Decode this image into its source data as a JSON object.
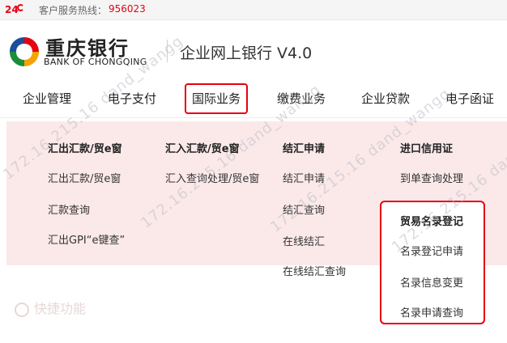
{
  "topbar": {
    "hotline_label": "客户服务热线：",
    "hotline_number": "956023",
    "badge_text": "24"
  },
  "brand": {
    "name_cn": "重庆银行",
    "name_en": "BANK OF CHONGQING",
    "portal_title": "企业网上银行 V4.0"
  },
  "nav": {
    "items": [
      {
        "label": "企业管理"
      },
      {
        "label": "电子支付"
      },
      {
        "label": "国际业务"
      },
      {
        "label": "缴费业务"
      },
      {
        "label": "企业贷款"
      },
      {
        "label": "电子函证"
      }
    ]
  },
  "menu": {
    "col1": {
      "heading": "汇出汇款/贸e窗",
      "links": [
        "汇出汇款/贸e窗",
        "汇款查询",
        "汇出GPI“e键查”"
      ]
    },
    "col2": {
      "heading": "汇入汇款/贸e窗",
      "links": [
        "汇入查询处理/贸e窗"
      ]
    },
    "col3": {
      "heading": "结汇申请",
      "links": [
        "结汇申请",
        "结汇查询",
        "在线结汇",
        "在线结汇查询"
      ]
    },
    "col4": {
      "heading": "进口信用证",
      "links": [
        "到单查询处理"
      ]
    },
    "col5": {
      "heading": "贸易名录登记",
      "links": [
        "名录登记申请",
        "名录信息变更",
        "名录申请查询"
      ]
    }
  },
  "background": {
    "quick_label": "快捷功能"
  },
  "watermark": {
    "text": "172.16.215.16 dand_wangg"
  },
  "colors": {
    "accent": "#e60012",
    "panel_bg": "#fbe9e9"
  }
}
